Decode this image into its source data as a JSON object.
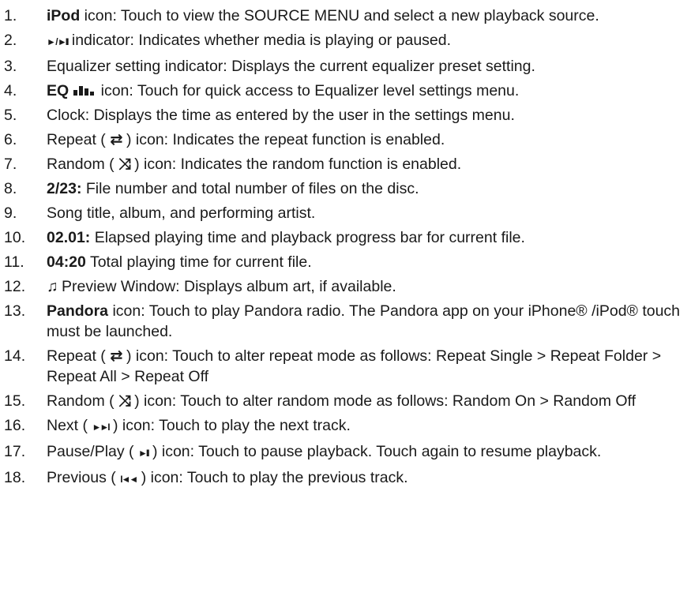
{
  "items": [
    {
      "n": "1.",
      "bold": "iPod",
      "text": " icon: Touch to view the SOURCE MENU and select a new playback source."
    },
    {
      "n": "2.",
      "pre_icon": "► / ►II",
      "text": " indicator: Indicates whether media is playing or paused."
    },
    {
      "n": "3.",
      "text": "Equalizer setting indicator: Displays the current equalizer preset setting."
    },
    {
      "n": "4.",
      "bold": "EQ",
      "text": " icon: Touch for quick access to Equalizer level settings menu."
    },
    {
      "n": "5.",
      "text": "Clock: Displays the time as entered by the user in the settings menu."
    },
    {
      "n": "6.",
      "lead": "Repeat ( ",
      "icon": "⇄",
      "text": " ) icon: Indicates the repeat function is enabled."
    },
    {
      "n": "7.",
      "lead": "Random ( ",
      "icon": "⤨",
      "text": " ) icon: Indicates the random function is enabled."
    },
    {
      "n": "8.",
      "bold": "2/23:",
      "text": " File number and total number of files on the disc."
    },
    {
      "n": "9.",
      "text": "Song title, album, and performing artist."
    },
    {
      "n": "10.",
      "bold": "02.01:",
      "text": " Elapsed playing time and playback progress bar for current file."
    },
    {
      "n": "11.",
      "bold": "04:20",
      "text": " Total playing time for current file."
    },
    {
      "n": "12.",
      "pre_icon": "♫",
      "text": " Preview Window: Displays album art, if available."
    },
    {
      "n": "13.",
      "bold": "Pandora",
      "text": " icon: Touch to play Pandora radio. The Pandora app on your iPhone® /iPod® touch must be launched."
    },
    {
      "n": "14.",
      "lead": "Repeat ( ",
      "icon": "⇄",
      "text": " ) icon: Touch to alter repeat mode as follows: Repeat Single > Repeat Folder > Repeat All > Repeat Off"
    },
    {
      "n": "15.",
      "lead": "Random ( ",
      "icon": "⤨",
      "text": " ) icon: Touch to alter random mode as follows: Random On > Random Off"
    },
    {
      "n": "16.",
      "lead": "Next ( ",
      "icon": "►►I",
      "text": " ) icon: Touch to play the next track."
    },
    {
      "n": "17.",
      "lead": "Pause/Play ( ",
      "icon": "►II",
      "text": " ) icon: Touch to pause playback. Touch again to resume playback."
    },
    {
      "n": "18.",
      "lead": "Previous ( ",
      "icon": "I◄◄",
      "text": " ) icon: Touch to play the previous track."
    }
  ]
}
